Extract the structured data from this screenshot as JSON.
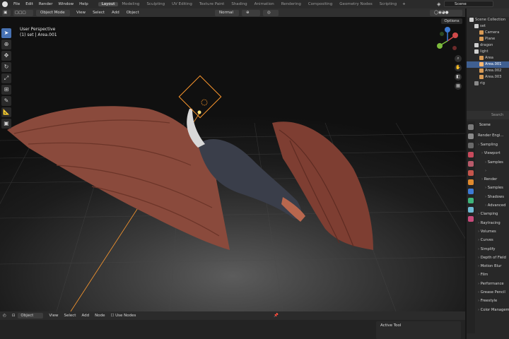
{
  "topbar": {
    "menus": [
      "File",
      "Edit",
      "Render",
      "Window",
      "Help"
    ],
    "workspaces": [
      "Layout",
      "Modeling",
      "Sculpting",
      "UV Editing",
      "Texture Paint",
      "Shading",
      "Animation",
      "Rendering",
      "Compositing",
      "Geometry Nodes",
      "Scripting"
    ],
    "active_workspace": "Layout",
    "add_tab": "+",
    "scene_name": "Scene"
  },
  "viewport_header": {
    "mode": "Object Mode",
    "menus": [
      "View",
      "Select",
      "Add",
      "Object"
    ],
    "transform_orientation": "Normal"
  },
  "viewport": {
    "perspective": "User Perspective",
    "context": "(1) set | Area.001",
    "options_label": "Options",
    "gizmo_axes": [
      "X",
      "Y",
      "Z"
    ]
  },
  "bottom_header": {
    "mode": "Object",
    "menus": [
      "View",
      "Select",
      "Add",
      "Node"
    ],
    "use_nodes_label": "Use Nodes"
  },
  "active_tool": {
    "label": "Active Tool"
  },
  "outliner": {
    "rows": [
      {
        "label": "Scene Collection",
        "icon": "collection-icon",
        "color": "#cfcfcf",
        "indent": 0,
        "selected": false
      },
      {
        "label": "set",
        "icon": "collection-icon",
        "color": "#cfcfcf",
        "indent": 1,
        "selected": false
      },
      {
        "label": "Camera",
        "icon": "camera-icon",
        "color": "#d89a55",
        "indent": 2,
        "selected": false
      },
      {
        "label": "Plane",
        "icon": "mesh-icon",
        "color": "#d89a55",
        "indent": 2,
        "selected": false
      },
      {
        "label": "dragon",
        "icon": "collection-icon",
        "color": "#cfcfcf",
        "indent": 1,
        "selected": false
      },
      {
        "label": "light",
        "icon": "collection-icon",
        "color": "#cfcfcf",
        "indent": 1,
        "selected": false
      },
      {
        "label": "Area",
        "icon": "light-icon",
        "color": "#d89a55",
        "indent": 2,
        "selected": false
      },
      {
        "label": "Area.001",
        "icon": "light-icon",
        "color": "#ffb770",
        "indent": 2,
        "selected": true
      },
      {
        "label": "Area.002",
        "icon": "light-icon",
        "color": "#d89a55",
        "indent": 2,
        "selected": false
      },
      {
        "label": "Area.003",
        "icon": "light-icon",
        "color": "#d89a55",
        "indent": 2,
        "selected": false
      },
      {
        "label": "rig",
        "icon": "collection-icon",
        "color": "#8a8a8a",
        "indent": 1,
        "selected": false
      }
    ]
  },
  "properties": {
    "search_placeholder": "Search",
    "scene_label": "Scene",
    "render_engine_label": "Render Engi...",
    "rows": [
      {
        "label": "Sampling",
        "indent": 0
      },
      {
        "label": "Viewport",
        "indent": 1
      },
      {
        "label": "Samples",
        "indent": 2
      },
      {
        "label": "",
        "indent": 2
      },
      {
        "label": "Render",
        "indent": 1
      },
      {
        "label": "Samples",
        "indent": 2
      },
      {
        "label": "Shadows",
        "indent": 2
      },
      {
        "label": "Advanced",
        "indent": 2
      },
      {
        "label": "Clamping",
        "indent": 0
      },
      {
        "label": "Raytracing",
        "indent": 0
      },
      {
        "label": "Volumes",
        "indent": 0
      },
      {
        "label": "Curves",
        "indent": 0
      },
      {
        "label": "Simplify",
        "indent": 0
      },
      {
        "label": "Depth of Field",
        "indent": 0
      },
      {
        "label": "Motion Blur",
        "indent": 0
      },
      {
        "label": "Film",
        "indent": 0
      },
      {
        "label": "Performance",
        "indent": 0
      },
      {
        "label": "Grease Pencil",
        "indent": 0
      },
      {
        "label": "Freestyle",
        "indent": 0
      },
      {
        "label": "Color Management",
        "indent": 0
      }
    ]
  },
  "colors": {
    "accent": "#4772b3",
    "light_outline": "#ff9a2e",
    "dragon_wing": "#8a4a3c",
    "selected_row": "#3f5f91"
  }
}
